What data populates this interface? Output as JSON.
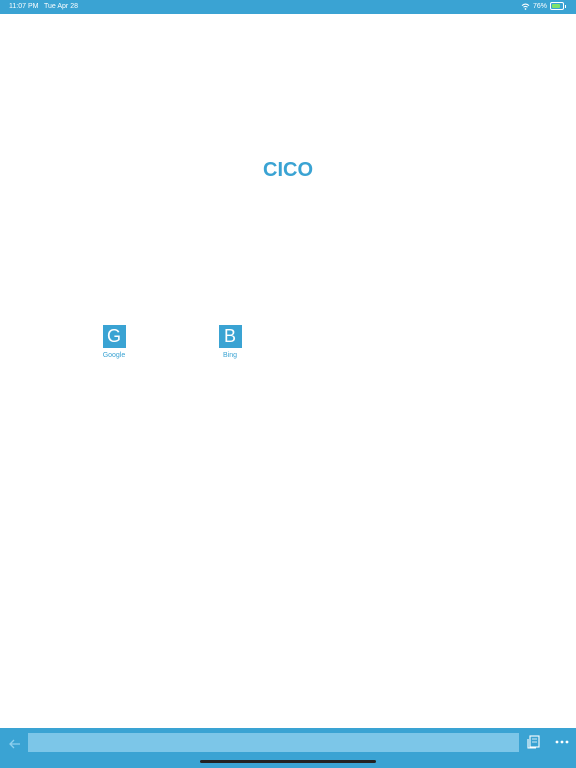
{
  "status_bar": {
    "time": "11:07 PM",
    "date": "Tue Apr 28",
    "battery_percent": "76%",
    "battery_level": 0.76
  },
  "main": {
    "title": "CICO",
    "shortcuts": [
      {
        "letter": "G",
        "label": "Google"
      },
      {
        "letter": "B",
        "label": "Bing"
      }
    ]
  },
  "toolbar": {
    "address_value": "",
    "address_placeholder": ""
  },
  "colors": {
    "accent": "#3aa3d3",
    "address_bar": "#7cc6e8",
    "background": "#ffffff"
  },
  "icons": [
    "wifi-icon",
    "battery-icon",
    "back-arrow-icon",
    "tabs-icon",
    "more-icon"
  ]
}
